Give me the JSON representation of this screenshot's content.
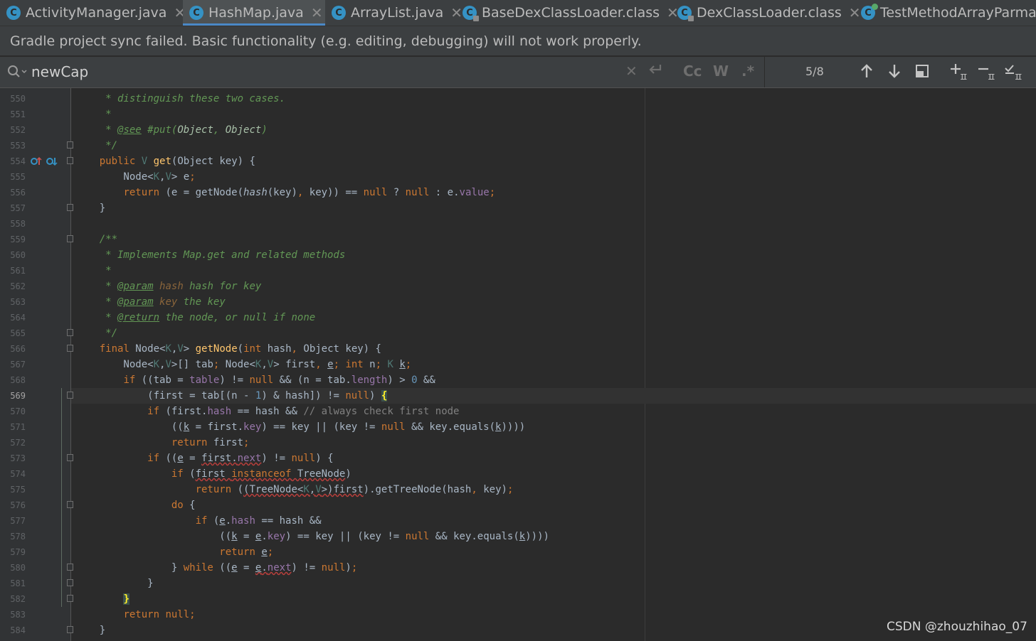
{
  "tabs": [
    {
      "label": "ActivityManager.java",
      "active": false
    },
    {
      "label": "HashMap.java",
      "active": true
    },
    {
      "label": "ArrayList.java",
      "active": false
    },
    {
      "label": "BaseDexClassLoader.class",
      "active": false
    },
    {
      "label": "DexClassLoader.class",
      "active": false
    },
    {
      "label": "TestMethodArrayParma",
      "active": false
    }
  ],
  "tab_icon_letter": "C",
  "banner": {
    "text": "Gradle project sync failed. Basic functionality (e.g. editing, debugging) will not work properly."
  },
  "find": {
    "query": "newCap",
    "match_case": "Cc",
    "words": "W",
    "regex": ".*",
    "count": "5/8"
  },
  "gutter": {
    "lines": [
      "550",
      "551",
      "552",
      "553",
      "554",
      "555",
      "556",
      "557",
      "558",
      "559",
      "560",
      "561",
      "562",
      "563",
      "564",
      "565",
      "566",
      "567",
      "568",
      "569",
      "570",
      "571",
      "572",
      "573",
      "574",
      "575",
      "576",
      "577",
      "578",
      "579",
      "580",
      "581",
      "582",
      "583",
      "584"
    ],
    "current_line": "569"
  },
  "watermark": "CSDN @zhouzhihao_07",
  "colors": {
    "accent": "#4a88c7",
    "keyword": "#cc7832",
    "comment": "#629755",
    "function": "#ffc66d",
    "field": "#9876aa",
    "number": "#6897bb"
  }
}
